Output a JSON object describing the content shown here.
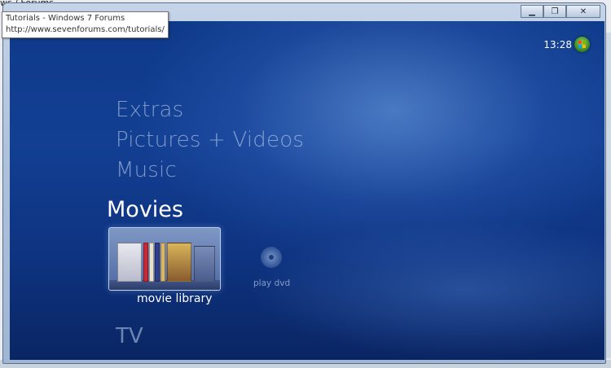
{
  "background_page": {
    "breadcrumb": "ws / Forums"
  },
  "tooltip": {
    "title": "Tutorials - Windows 7 Forums",
    "url": "http://www.sevenforums.com/tutorials/"
  },
  "window": {
    "controls": {
      "minimize_icon": "minimize-icon",
      "restore_icon": "restore-icon",
      "close_icon": "close-icon",
      "minimize": "▁",
      "restore": "❐",
      "close": "✕"
    }
  },
  "media_center": {
    "clock": "13:28",
    "start_orb_icon": "windows-orb-icon",
    "menu": {
      "extras": "Extras",
      "pictures_videos": "Pictures + Videos",
      "music": "Music",
      "movies": "Movies",
      "tv": "TV"
    },
    "strip": {
      "movie_library": "movie library",
      "play_dvd": "play dvd",
      "dvd_icon": "dvd-icon"
    }
  },
  "colors": {
    "mc_bg_top": "#0f3a8a",
    "mc_bg_bottom": "#0a2563",
    "accent_text": "#ffffff",
    "dim_text": "#bed2eb"
  }
}
